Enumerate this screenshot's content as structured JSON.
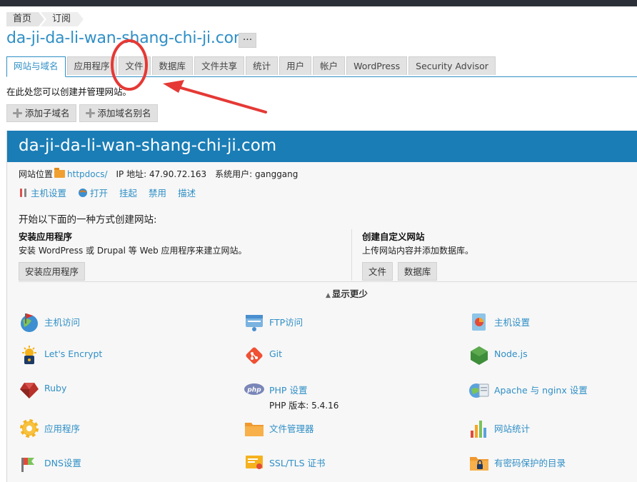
{
  "breadcrumb": {
    "home": "首页",
    "current": "订阅"
  },
  "domain": {
    "title": "da-ji-da-li-wan-shang-chi-ji.com",
    "more": "···"
  },
  "tabs": [
    {
      "label": "网站与域名",
      "active": true
    },
    {
      "label": "应用程序"
    },
    {
      "label": "文件"
    },
    {
      "label": "数据库"
    },
    {
      "label": "文件共享"
    },
    {
      "label": "统计"
    },
    {
      "label": "用户"
    },
    {
      "label": "帐户"
    },
    {
      "label": "WordPress"
    },
    {
      "label": "Security Advisor"
    }
  ],
  "intro": "在此处您可以创建并管理网站。",
  "toolbar": {
    "add_subdomain": "添加子域名",
    "add_alias": "添加域名别名"
  },
  "site": {
    "name": "da-ji-da-li-wan-shang-chi-ji.com",
    "location_label": "网站位置",
    "location_link": "httpdocs/",
    "ip_label": "IP 地址:",
    "ip_value": "47.90.72.163",
    "user_label": "系统用户:",
    "user_value": "ganggang",
    "actions": {
      "hosting": "主机设置",
      "open": "打开",
      "suspend": "挂起",
      "disable": "禁用",
      "describe": "描述"
    }
  },
  "create": {
    "prompt": "开始以下面的一种方式创建网站:",
    "install_title": "安装应用程序",
    "install_desc": "安装 WordPress 或 Drupal 等 Web 应用程序来建立网站。",
    "install_button": "安装应用程序",
    "custom_title": "创建自定义网站",
    "custom_desc": "上传网站内容并添加数据库。",
    "files_button": "文件",
    "db_button": "数据库"
  },
  "show_less": "显示更少",
  "features": [
    {
      "label": "主机访问",
      "icon": "hosting-access-icon"
    },
    {
      "label": "FTP访问",
      "icon": "ftp-icon"
    },
    {
      "label": "主机设置",
      "icon": "hosting-settings-icon"
    },
    {
      "label": "Let's Encrypt",
      "icon": "lock-icon"
    },
    {
      "label": "Git",
      "icon": "git-icon"
    },
    {
      "label": "Node.js",
      "icon": "nodejs-icon"
    },
    {
      "label": "Ruby",
      "icon": "ruby-icon"
    },
    {
      "label": "PHP 设置",
      "sub": "PHP 版本: 5.4.16",
      "icon": "php-icon"
    },
    {
      "label": "Apache 与 nginx 设置",
      "icon": "apache-icon"
    },
    {
      "label": "应用程序",
      "icon": "gear-icon"
    },
    {
      "label": "文件管理器",
      "icon": "folder-icon"
    },
    {
      "label": "网站统计",
      "icon": "stats-icon"
    },
    {
      "label": "DNS设置",
      "icon": "dns-icon"
    },
    {
      "label": "SSL/TLS 证书",
      "icon": "certificate-icon"
    },
    {
      "label": "有密码保护的目录",
      "icon": "protected-folder-icon"
    }
  ],
  "colors": {
    "accent": "#2f8fc6",
    "header": "#1a7db6",
    "annotation": "#e53935"
  }
}
